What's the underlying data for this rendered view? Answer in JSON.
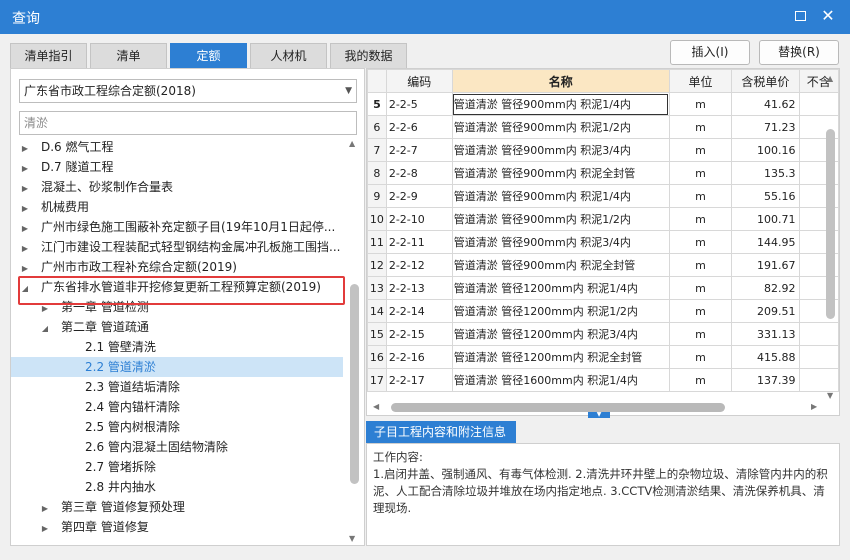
{
  "window": {
    "title": "查询"
  },
  "tabs": [
    {
      "label": "清单指引",
      "active": false
    },
    {
      "label": "清单",
      "active": false
    },
    {
      "label": "定额",
      "active": true
    },
    {
      "label": "人材机",
      "active": false
    },
    {
      "label": "我的数据",
      "active": false
    }
  ],
  "toolbar": {
    "insert_label": "插入(I)",
    "replace_label": "替换(R)"
  },
  "left": {
    "library": "广东省市政工程综合定额(2018)",
    "search_value": "清淤",
    "tree": [
      {
        "label": "D.6 燃气工程",
        "expander": "collapsed",
        "level": 1
      },
      {
        "label": "D.7 隧道工程",
        "expander": "collapsed",
        "level": 1
      },
      {
        "label": "混凝土、砂浆制作合量表",
        "expander": "collapsed",
        "level": 1
      },
      {
        "label": "机械费用",
        "expander": "collapsed",
        "level": 1
      },
      {
        "label": "广州市绿色施工围蔽补充定额子目(19年10月1日起停...",
        "expander": "collapsed",
        "level": 1
      },
      {
        "label": "江门市建设工程装配式轻型钢结构金属冲孔板施工围挡...",
        "expander": "collapsed",
        "level": 1
      },
      {
        "label": "广州市市政工程补充综合定额(2019)",
        "expander": "collapsed",
        "level": 1
      },
      {
        "label": "广东省排水管道非开挖修复更新工程预算定额(2019)",
        "expander": "expanded",
        "level": 1
      },
      {
        "label": "第一章 管道检测",
        "expander": "collapsed",
        "level": 2
      },
      {
        "label": "第二章 管道疏通",
        "expander": "expanded",
        "level": 2
      },
      {
        "label": "2.1 管壁清洗",
        "expander": "none",
        "level": 3
      },
      {
        "label": "2.2 管道清淤",
        "expander": "none",
        "level": 3,
        "selected": true
      },
      {
        "label": "2.3 管道结垢清除",
        "expander": "none",
        "level": 3
      },
      {
        "label": "2.4 管内锚杆清除",
        "expander": "none",
        "level": 3
      },
      {
        "label": "2.5 管内树根清除",
        "expander": "none",
        "level": 3
      },
      {
        "label": "2.6 管内混凝土固结物清除",
        "expander": "none",
        "level": 3
      },
      {
        "label": "2.7 管堵拆除",
        "expander": "none",
        "level": 3
      },
      {
        "label": "2.8 井内抽水",
        "expander": "none",
        "level": 3
      },
      {
        "label": "第三章 管道修复预处理",
        "expander": "collapsed",
        "level": 2
      },
      {
        "label": "第四章 管道修复",
        "expander": "collapsed",
        "level": 2
      }
    ]
  },
  "grid": {
    "columns": [
      "编码",
      "名称",
      "单位",
      "含税单价",
      "不含"
    ],
    "rows": [
      {
        "n": "5",
        "code": "2-2-5",
        "name": "管道清淤 管径900mm内 积泥1/4内",
        "unit": "m",
        "price": "41.62",
        "current": true
      },
      {
        "n": "6",
        "code": "2-2-6",
        "name": "管道清淤 管径900mm内 积泥1/2内",
        "unit": "m",
        "price": "71.23"
      },
      {
        "n": "7",
        "code": "2-2-7",
        "name": "管道清淤 管径900mm内 积泥3/4内",
        "unit": "m",
        "price": "100.16"
      },
      {
        "n": "8",
        "code": "2-2-8",
        "name": "管道清淤 管径900mm内 积泥全封管",
        "unit": "m",
        "price": "135.3"
      },
      {
        "n": "9",
        "code": "2-2-9",
        "name": "管道清淤 管径900mm内 积泥1/4内",
        "unit": "m",
        "price": "55.16"
      },
      {
        "n": "10",
        "code": "2-2-10",
        "name": "管道清淤 管径900mm内 积泥1/2内",
        "unit": "m",
        "price": "100.71"
      },
      {
        "n": "11",
        "code": "2-2-11",
        "name": "管道清淤 管径900mm内 积泥3/4内",
        "unit": "m",
        "price": "144.95"
      },
      {
        "n": "12",
        "code": "2-2-12",
        "name": "管道清淤 管径900mm内 积泥全封管",
        "unit": "m",
        "price": "191.67"
      },
      {
        "n": "13",
        "code": "2-2-13",
        "name": "管道清淤 管径1200mm内 积泥1/4内",
        "unit": "m",
        "price": "82.92"
      },
      {
        "n": "14",
        "code": "2-2-14",
        "name": "管道清淤 管径1200mm内 积泥1/2内",
        "unit": "m",
        "price": "209.51"
      },
      {
        "n": "15",
        "code": "2-2-15",
        "name": "管道清淤 管径1200mm内 积泥3/4内",
        "unit": "m",
        "price": "331.13"
      },
      {
        "n": "16",
        "code": "2-2-16",
        "name": "管道清淤 管径1200mm内 积泥全封管",
        "unit": "m",
        "price": "415.88"
      },
      {
        "n": "17",
        "code": "2-2-17",
        "name": "管道清淤 管径1600mm内 积泥1/4内",
        "unit": "m",
        "price": "137.39"
      }
    ]
  },
  "info": {
    "tab_label": "子目工程内容和附注信息",
    "heading": "工作内容:",
    "body": "1.启闭井盖、强制通风、有毒气体检测. 2.清洗井环井壁上的杂物垃圾、清除管内井内的积泥、人工配合清除垃圾并堆放在场内指定地点. 3.CCTV检测清淤结果、清洗保养机具、清理现场."
  },
  "colors": {
    "accent": "#2d7fd3",
    "highlight_box": "#e23b3b",
    "selected_row": "#cde4f7",
    "name_header": "#fbe7c3"
  },
  "icons": {
    "maximize": "maximize-icon",
    "close": "close-icon",
    "expanded": "triangle-down-icon",
    "collapsed": "triangle-right-icon"
  }
}
